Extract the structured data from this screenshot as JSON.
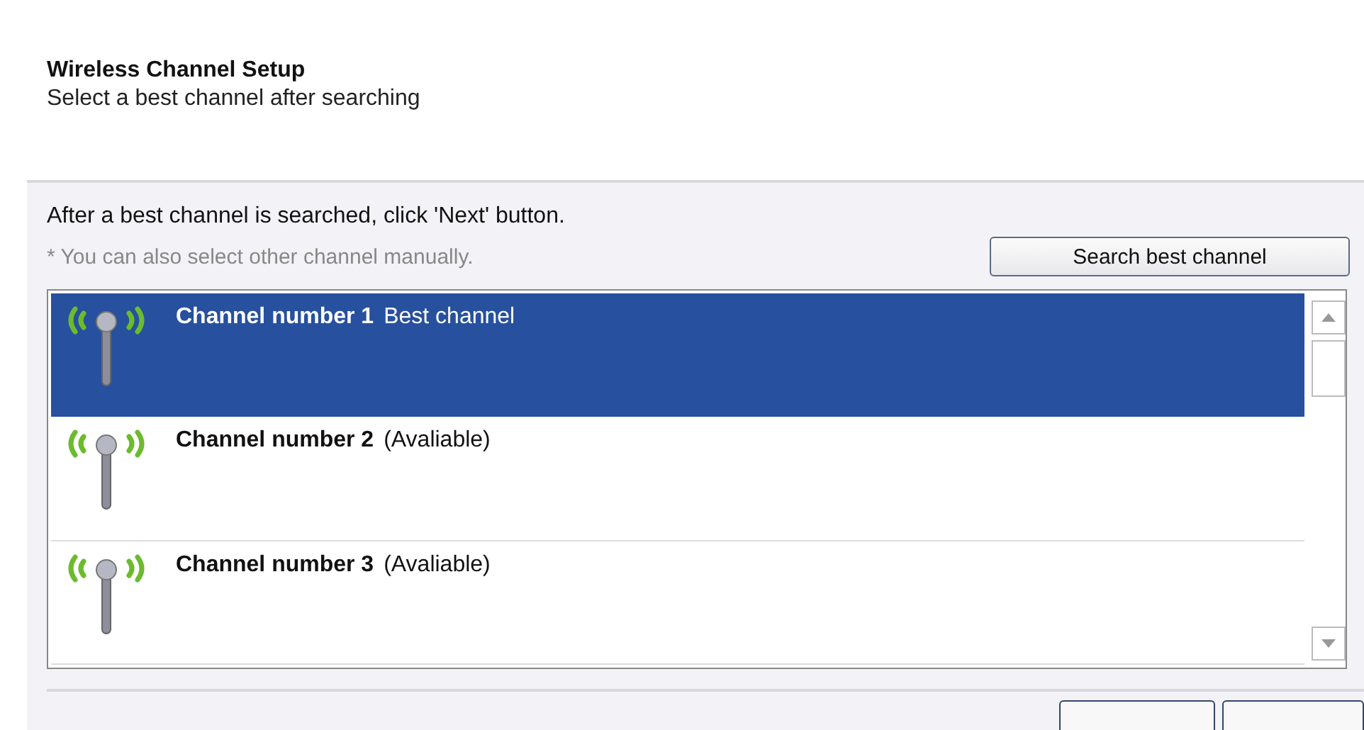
{
  "header": {
    "title": "Wireless Channel Setup",
    "subtitle": "Select a best channel after searching"
  },
  "instruction": "After a best channel is searched, click 'Next' button.",
  "note": "* You can also select other channel manually.",
  "search_button": "Search best channel",
  "channels": [
    {
      "name": "Channel number 1",
      "status": "Best channel",
      "selected": true
    },
    {
      "name": "Channel number 2",
      "status": "(Avaliable)",
      "selected": false
    },
    {
      "name": "Channel number 3",
      "status": "(Avaliable)",
      "selected": false
    }
  ]
}
